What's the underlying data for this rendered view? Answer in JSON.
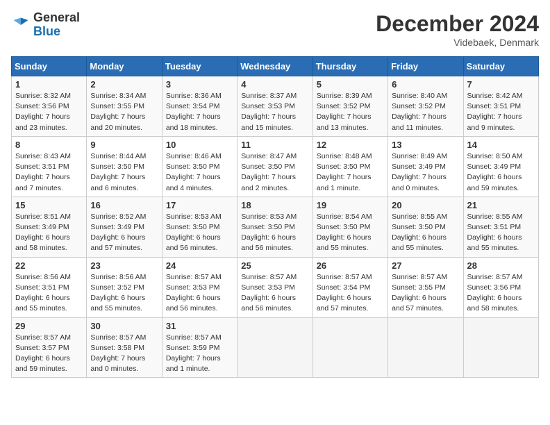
{
  "header": {
    "logo_line1": "General",
    "logo_line2": "Blue",
    "month_title": "December 2024",
    "location": "Videbaek, Denmark"
  },
  "days_of_week": [
    "Sunday",
    "Monday",
    "Tuesday",
    "Wednesday",
    "Thursday",
    "Friday",
    "Saturday"
  ],
  "weeks": [
    [
      {
        "day": "1",
        "info": "Sunrise: 8:32 AM\nSunset: 3:56 PM\nDaylight: 7 hours\nand 23 minutes."
      },
      {
        "day": "2",
        "info": "Sunrise: 8:34 AM\nSunset: 3:55 PM\nDaylight: 7 hours\nand 20 minutes."
      },
      {
        "day": "3",
        "info": "Sunrise: 8:36 AM\nSunset: 3:54 PM\nDaylight: 7 hours\nand 18 minutes."
      },
      {
        "day": "4",
        "info": "Sunrise: 8:37 AM\nSunset: 3:53 PM\nDaylight: 7 hours\nand 15 minutes."
      },
      {
        "day": "5",
        "info": "Sunrise: 8:39 AM\nSunset: 3:52 PM\nDaylight: 7 hours\nand 13 minutes."
      },
      {
        "day": "6",
        "info": "Sunrise: 8:40 AM\nSunset: 3:52 PM\nDaylight: 7 hours\nand 11 minutes."
      },
      {
        "day": "7",
        "info": "Sunrise: 8:42 AM\nSunset: 3:51 PM\nDaylight: 7 hours\nand 9 minutes."
      }
    ],
    [
      {
        "day": "8",
        "info": "Sunrise: 8:43 AM\nSunset: 3:51 PM\nDaylight: 7 hours\nand 7 minutes."
      },
      {
        "day": "9",
        "info": "Sunrise: 8:44 AM\nSunset: 3:50 PM\nDaylight: 7 hours\nand 6 minutes."
      },
      {
        "day": "10",
        "info": "Sunrise: 8:46 AM\nSunset: 3:50 PM\nDaylight: 7 hours\nand 4 minutes."
      },
      {
        "day": "11",
        "info": "Sunrise: 8:47 AM\nSunset: 3:50 PM\nDaylight: 7 hours\nand 2 minutes."
      },
      {
        "day": "12",
        "info": "Sunrise: 8:48 AM\nSunset: 3:50 PM\nDaylight: 7 hours\nand 1 minute."
      },
      {
        "day": "13",
        "info": "Sunrise: 8:49 AM\nSunset: 3:49 PM\nDaylight: 7 hours\nand 0 minutes."
      },
      {
        "day": "14",
        "info": "Sunrise: 8:50 AM\nSunset: 3:49 PM\nDaylight: 6 hours\nand 59 minutes."
      }
    ],
    [
      {
        "day": "15",
        "info": "Sunrise: 8:51 AM\nSunset: 3:49 PM\nDaylight: 6 hours\nand 58 minutes."
      },
      {
        "day": "16",
        "info": "Sunrise: 8:52 AM\nSunset: 3:49 PM\nDaylight: 6 hours\nand 57 minutes."
      },
      {
        "day": "17",
        "info": "Sunrise: 8:53 AM\nSunset: 3:50 PM\nDaylight: 6 hours\nand 56 minutes."
      },
      {
        "day": "18",
        "info": "Sunrise: 8:53 AM\nSunset: 3:50 PM\nDaylight: 6 hours\nand 56 minutes."
      },
      {
        "day": "19",
        "info": "Sunrise: 8:54 AM\nSunset: 3:50 PM\nDaylight: 6 hours\nand 55 minutes."
      },
      {
        "day": "20",
        "info": "Sunrise: 8:55 AM\nSunset: 3:50 PM\nDaylight: 6 hours\nand 55 minutes."
      },
      {
        "day": "21",
        "info": "Sunrise: 8:55 AM\nSunset: 3:51 PM\nDaylight: 6 hours\nand 55 minutes."
      }
    ],
    [
      {
        "day": "22",
        "info": "Sunrise: 8:56 AM\nSunset: 3:51 PM\nDaylight: 6 hours\nand 55 minutes."
      },
      {
        "day": "23",
        "info": "Sunrise: 8:56 AM\nSunset: 3:52 PM\nDaylight: 6 hours\nand 55 minutes."
      },
      {
        "day": "24",
        "info": "Sunrise: 8:57 AM\nSunset: 3:53 PM\nDaylight: 6 hours\nand 56 minutes."
      },
      {
        "day": "25",
        "info": "Sunrise: 8:57 AM\nSunset: 3:53 PM\nDaylight: 6 hours\nand 56 minutes."
      },
      {
        "day": "26",
        "info": "Sunrise: 8:57 AM\nSunset: 3:54 PM\nDaylight: 6 hours\nand 57 minutes."
      },
      {
        "day": "27",
        "info": "Sunrise: 8:57 AM\nSunset: 3:55 PM\nDaylight: 6 hours\nand 57 minutes."
      },
      {
        "day": "28",
        "info": "Sunrise: 8:57 AM\nSunset: 3:56 PM\nDaylight: 6 hours\nand 58 minutes."
      }
    ],
    [
      {
        "day": "29",
        "info": "Sunrise: 8:57 AM\nSunset: 3:57 PM\nDaylight: 6 hours\nand 59 minutes."
      },
      {
        "day": "30",
        "info": "Sunrise: 8:57 AM\nSunset: 3:58 PM\nDaylight: 7 hours\nand 0 minutes."
      },
      {
        "day": "31",
        "info": "Sunrise: 8:57 AM\nSunset: 3:59 PM\nDaylight: 7 hours\nand 1 minute."
      },
      {
        "day": "",
        "info": ""
      },
      {
        "day": "",
        "info": ""
      },
      {
        "day": "",
        "info": ""
      },
      {
        "day": "",
        "info": ""
      }
    ]
  ]
}
